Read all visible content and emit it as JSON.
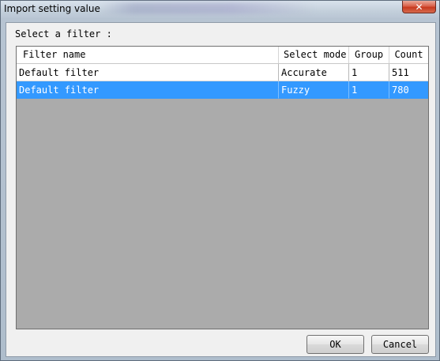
{
  "window": {
    "title": "Import setting value",
    "close_symbol": "✕"
  },
  "prompt": "Select a filter :",
  "table": {
    "columns": [
      "Filter name",
      "Select mode",
      "Group",
      "Count"
    ],
    "rows": [
      {
        "filter_name": "Default filter",
        "select_mode": "Accurate",
        "group": "1",
        "count": "511",
        "selected": false
      },
      {
        "filter_name": "Default filter",
        "select_mode": "Fuzzy",
        "group": "1",
        "count": "780",
        "selected": true
      }
    ]
  },
  "buttons": {
    "ok": "OK",
    "cancel": "Cancel"
  },
  "colors": {
    "selection": "#3399ff",
    "grid_background": "#ababab"
  }
}
